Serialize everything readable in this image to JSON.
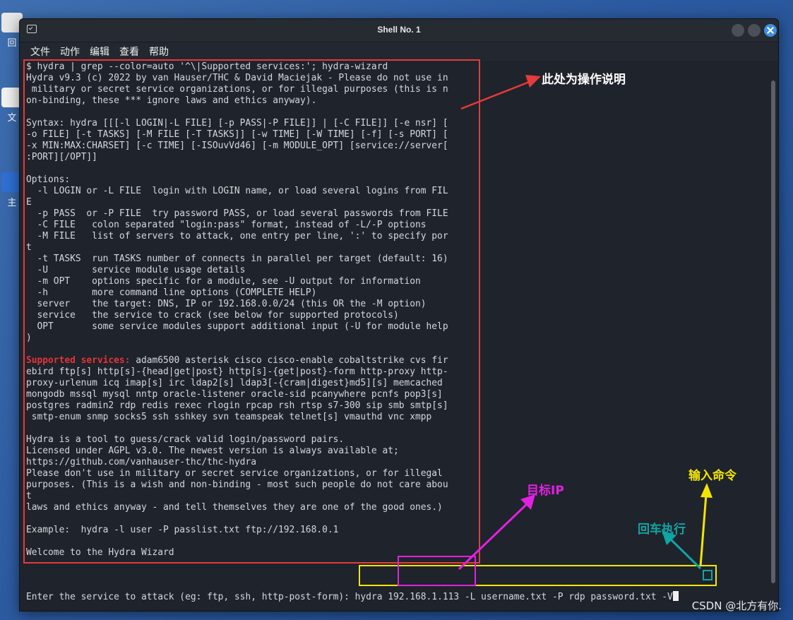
{
  "window": {
    "title": "Shell No. 1"
  },
  "menu": [
    "文件",
    "动作",
    "编辑",
    "查看",
    "帮助"
  ],
  "desktop_icons": [
    "回",
    "文",
    "主"
  ],
  "terminal": {
    "lines": [
      "$ hydra | grep --color=auto '^\\|Supported services:'; hydra-wizard",
      "Hydra v9.3 (c) 2022 by van Hauser/THC & David Maciejak - Please do not use in",
      " military or secret service organizations, or for illegal purposes (this is n",
      "on-binding, these *** ignore laws and ethics anyway).",
      "",
      "Syntax: hydra [[[-l LOGIN|-L FILE] [-p PASS|-P FILE]] | [-C FILE]] [-e nsr] [",
      "-o FILE] [-t TASKS] [-M FILE [-T TASKS]] [-w TIME] [-W TIME] [-f] [-s PORT] [",
      "-x MIN:MAX:CHARSET] [-c TIME] [-ISOuvVd46] [-m MODULE_OPT] [service://server[",
      ":PORT][/OPT]]",
      "",
      "Options:",
      "  -l LOGIN or -L FILE  login with LOGIN name, or load several logins from FIL",
      "E",
      "  -p PASS  or -P FILE  try password PASS, or load several passwords from FILE",
      "  -C FILE   colon separated \"login:pass\" format, instead of -L/-P options",
      "  -M FILE   list of servers to attack, one entry per line, ':' to specify por",
      "t",
      "  -t TASKS  run TASKS number of connects in parallel per target (default: 16)",
      "  -U        service module usage details",
      "  -m OPT    options specific for a module, see -U output for information",
      "  -h        more command line options (COMPLETE HELP)",
      "  server    the target: DNS, IP or 192.168.0.0/24 (this OR the -M option)",
      "  service   the service to crack (see below for supported protocols)",
      "  OPT       some service modules support additional input (-U for module help",
      ")",
      "",
      "",
      "ebird ftp[s] http[s]-{head|get|post} http[s]-{get|post}-form http-proxy http-",
      "proxy-urlenum icq imap[s] irc ldap2[s] ldap3[-{cram|digest}md5][s] memcached",
      "mongodb mssql mysql nntp oracle-listener oracle-sid pcanywhere pcnfs pop3[s]",
      "postgres radmin2 rdp redis rexec rlogin rpcap rsh rtsp s7-300 sip smb smtp[s]",
      " smtp-enum snmp socks5 ssh sshkey svn teamspeak telnet[s] vmauthd vnc xmpp",
      "",
      "Hydra is a tool to guess/crack valid login/password pairs.",
      "Licensed under AGPL v3.0. The newest version is always available at;",
      "https://github.com/vanhauser-thc/thc-hydra",
      "Please don't use in military or secret service organizations, or for illegal",
      "purposes. (This is a wish and non-binding - most such people do not care abou",
      "t",
      "laws and ethics anyway - and tell themselves they are one of the good ones.)",
      "",
      "Example:  hydra -l user -P passlist.txt ftp://192.168.0.1",
      "",
      "Welcome to the Hydra Wizard",
      ""
    ],
    "supported_label": "Supported services:",
    "supported_rest": " adam6500 asterisk cisco cisco-enable cobaltstrike cvs fir",
    "prompt": "Enter the service to attack (eg: ftp, ssh, http-post-form): ",
    "command_input": "hydra 192.168.1.113 -L username.txt -P rdp password.txt -V"
  },
  "annotations": {
    "operation_desc": "此处为操作说明",
    "target_ip": "目标IP",
    "enter_command": "输入命令",
    "press_enter": "回车执行"
  },
  "annotation_colors": {
    "red": "#e53b3b",
    "yellow": "#f2e600",
    "magenta": "#e022e0",
    "teal": "#0fa5a5"
  },
  "watermark": "CSDN @北方有你."
}
